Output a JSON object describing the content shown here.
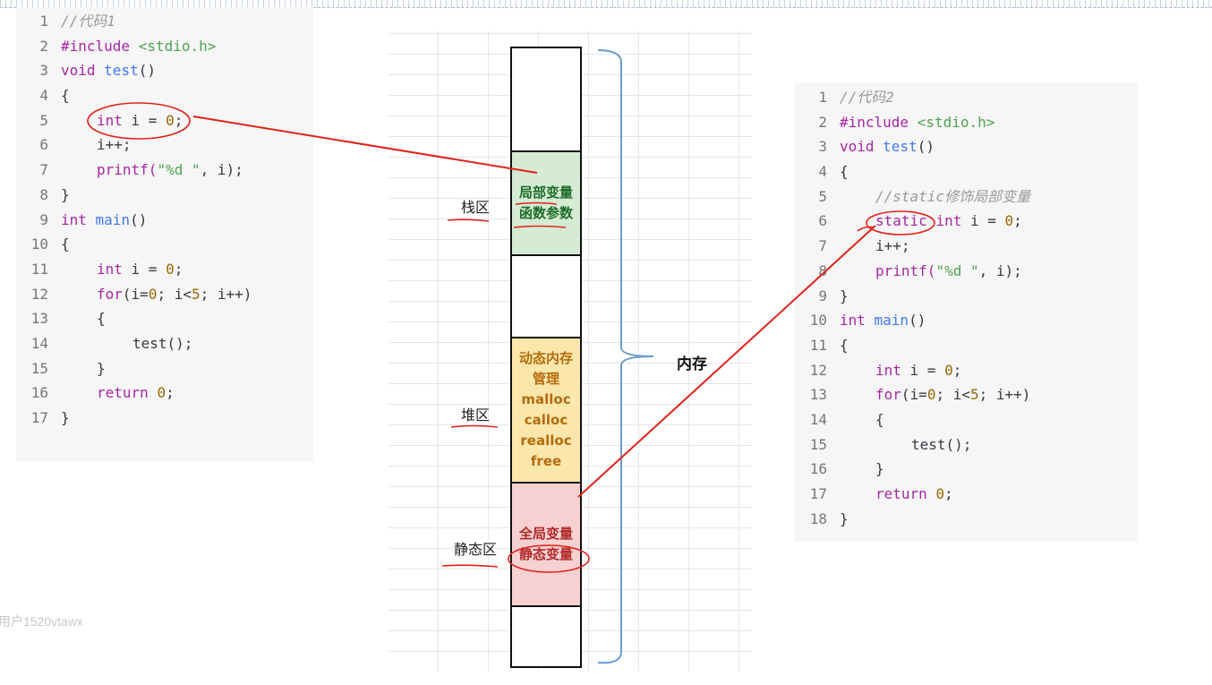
{
  "code_block_1": {
    "lines": [
      {
        "n": "1",
        "parts": [
          {
            "t": "//代码1",
            "c": "cm"
          }
        ]
      },
      {
        "n": "2",
        "parts": [
          {
            "t": "#include ",
            "c": "kw"
          },
          {
            "t": "<stdio.h>",
            "c": "st"
          }
        ]
      },
      {
        "n": "3",
        "parts": [
          {
            "t": "void ",
            "c": "kw"
          },
          {
            "t": "test",
            "c": "fn"
          },
          {
            "t": "()",
            "c": ""
          }
        ]
      },
      {
        "n": "4",
        "parts": [
          {
            "t": "{",
            "c": ""
          }
        ]
      },
      {
        "n": "5",
        "indent": 1,
        "parts": [
          {
            "t": "int ",
            "c": "kw"
          },
          {
            "t": "i = ",
            "c": ""
          },
          {
            "t": "0",
            "c": "nm"
          },
          {
            "t": ";",
            "c": ""
          }
        ]
      },
      {
        "n": "6",
        "indent": 1,
        "parts": [
          {
            "t": "i++;",
            "c": ""
          }
        ]
      },
      {
        "n": "7",
        "indent": 1,
        "parts": [
          {
            "t": "printf(",
            "c": "kw"
          },
          {
            "t": "\"%d \"",
            "c": "st"
          },
          {
            "t": ", i);",
            "c": ""
          }
        ]
      },
      {
        "n": "8",
        "parts": [
          {
            "t": "}",
            "c": ""
          }
        ]
      },
      {
        "n": "9",
        "parts": [
          {
            "t": "int ",
            "c": "kw"
          },
          {
            "t": "main",
            "c": "fn"
          },
          {
            "t": "()",
            "c": ""
          }
        ]
      },
      {
        "n": "10",
        "parts": [
          {
            "t": "{",
            "c": ""
          }
        ]
      },
      {
        "n": "11",
        "indent": 1,
        "parts": [
          {
            "t": "int ",
            "c": "kw"
          },
          {
            "t": "i = ",
            "c": ""
          },
          {
            "t": "0",
            "c": "nm"
          },
          {
            "t": ";",
            "c": ""
          }
        ]
      },
      {
        "n": "12",
        "indent": 1,
        "parts": [
          {
            "t": "for",
            "c": "kw"
          },
          {
            "t": "(i=",
            "c": ""
          },
          {
            "t": "0",
            "c": "nm"
          },
          {
            "t": "; i<",
            "c": ""
          },
          {
            "t": "5",
            "c": "nm"
          },
          {
            "t": "; i++)",
            "c": ""
          }
        ]
      },
      {
        "n": "13",
        "indent": 1,
        "parts": [
          {
            "t": "{",
            "c": ""
          }
        ]
      },
      {
        "n": "14",
        "indent": 2,
        "parts": [
          {
            "t": "test();",
            "c": ""
          }
        ]
      },
      {
        "n": "15",
        "indent": 1,
        "parts": [
          {
            "t": "}",
            "c": ""
          }
        ]
      },
      {
        "n": "16",
        "indent": 1,
        "parts": [
          {
            "t": "return ",
            "c": "kw"
          },
          {
            "t": "0",
            "c": "nm"
          },
          {
            "t": ";",
            "c": ""
          }
        ]
      },
      {
        "n": "17",
        "parts": [
          {
            "t": "}",
            "c": ""
          }
        ]
      }
    ]
  },
  "code_block_2": {
    "lines": [
      {
        "n": "1",
        "parts": [
          {
            "t": "//代码2",
            "c": "cm"
          }
        ]
      },
      {
        "n": "2",
        "parts": [
          {
            "t": "#include ",
            "c": "kw"
          },
          {
            "t": "<stdio.h>",
            "c": "st"
          }
        ]
      },
      {
        "n": "3",
        "parts": [
          {
            "t": "void ",
            "c": "kw"
          },
          {
            "t": "test",
            "c": "fn"
          },
          {
            "t": "()",
            "c": ""
          }
        ]
      },
      {
        "n": "4",
        "parts": [
          {
            "t": "{",
            "c": ""
          }
        ]
      },
      {
        "n": "5",
        "indent": 1,
        "parts": [
          {
            "t": "//static修饰局部变量",
            "c": "cm"
          }
        ]
      },
      {
        "n": "6",
        "indent": 1,
        "parts": [
          {
            "t": "static ",
            "c": "kw"
          },
          {
            "t": "int ",
            "c": "kw"
          },
          {
            "t": "i = ",
            "c": ""
          },
          {
            "t": "0",
            "c": "nm"
          },
          {
            "t": ";",
            "c": ""
          }
        ]
      },
      {
        "n": "7",
        "indent": 1,
        "parts": [
          {
            "t": "i++;",
            "c": ""
          }
        ]
      },
      {
        "n": "8",
        "indent": 1,
        "parts": [
          {
            "t": "printf(",
            "c": "kw"
          },
          {
            "t": "\"%d \"",
            "c": "st"
          },
          {
            "t": ", i);",
            "c": ""
          }
        ]
      },
      {
        "n": "9",
        "parts": [
          {
            "t": "}",
            "c": ""
          }
        ]
      },
      {
        "n": "10",
        "parts": [
          {
            "t": "int ",
            "c": "kw"
          },
          {
            "t": "main",
            "c": "fn"
          },
          {
            "t": "()",
            "c": ""
          }
        ]
      },
      {
        "n": "11",
        "parts": [
          {
            "t": "{",
            "c": ""
          }
        ]
      },
      {
        "n": "12",
        "indent": 1,
        "parts": [
          {
            "t": "int ",
            "c": "kw"
          },
          {
            "t": "i = ",
            "c": ""
          },
          {
            "t": "0",
            "c": "nm"
          },
          {
            "t": ";",
            "c": ""
          }
        ]
      },
      {
        "n": "13",
        "indent": 1,
        "parts": [
          {
            "t": "for",
            "c": "kw"
          },
          {
            "t": "(i=",
            "c": ""
          },
          {
            "t": "0",
            "c": "nm"
          },
          {
            "t": "; i<",
            "c": ""
          },
          {
            "t": "5",
            "c": "nm"
          },
          {
            "t": "; i++)",
            "c": ""
          }
        ]
      },
      {
        "n": "14",
        "indent": 1,
        "parts": [
          {
            "t": "{",
            "c": ""
          }
        ]
      },
      {
        "n": "15",
        "indent": 2,
        "parts": [
          {
            "t": "test();",
            "c": ""
          }
        ]
      },
      {
        "n": "16",
        "indent": 1,
        "parts": [
          {
            "t": "}",
            "c": ""
          }
        ]
      },
      {
        "n": "17",
        "indent": 1,
        "parts": [
          {
            "t": "return ",
            "c": "kw"
          },
          {
            "t": "0",
            "c": "nm"
          },
          {
            "t": ";",
            "c": ""
          }
        ]
      },
      {
        "n": "18",
        "parts": [
          {
            "t": "}",
            "c": ""
          }
        ]
      }
    ]
  },
  "memory_diagram": {
    "stack_label": "栈区",
    "heap_label": "堆区",
    "static_label": "静态区",
    "memory_label": "内存",
    "stack_segment": [
      "局部变量",
      "函数参数"
    ],
    "heap_segment": [
      "动态内存",
      "管理",
      "malloc",
      "calloc",
      "realloc",
      "free"
    ],
    "static_segment": [
      "全局变量",
      "静态变量"
    ],
    "colors": {
      "stack": "#d5ebd3",
      "heap": "#fbe6ac",
      "static": "#f7d1d1",
      "annotation": "#e0231b",
      "brace": "#6a9bd1"
    }
  },
  "watermark": "用户1520vtawx"
}
